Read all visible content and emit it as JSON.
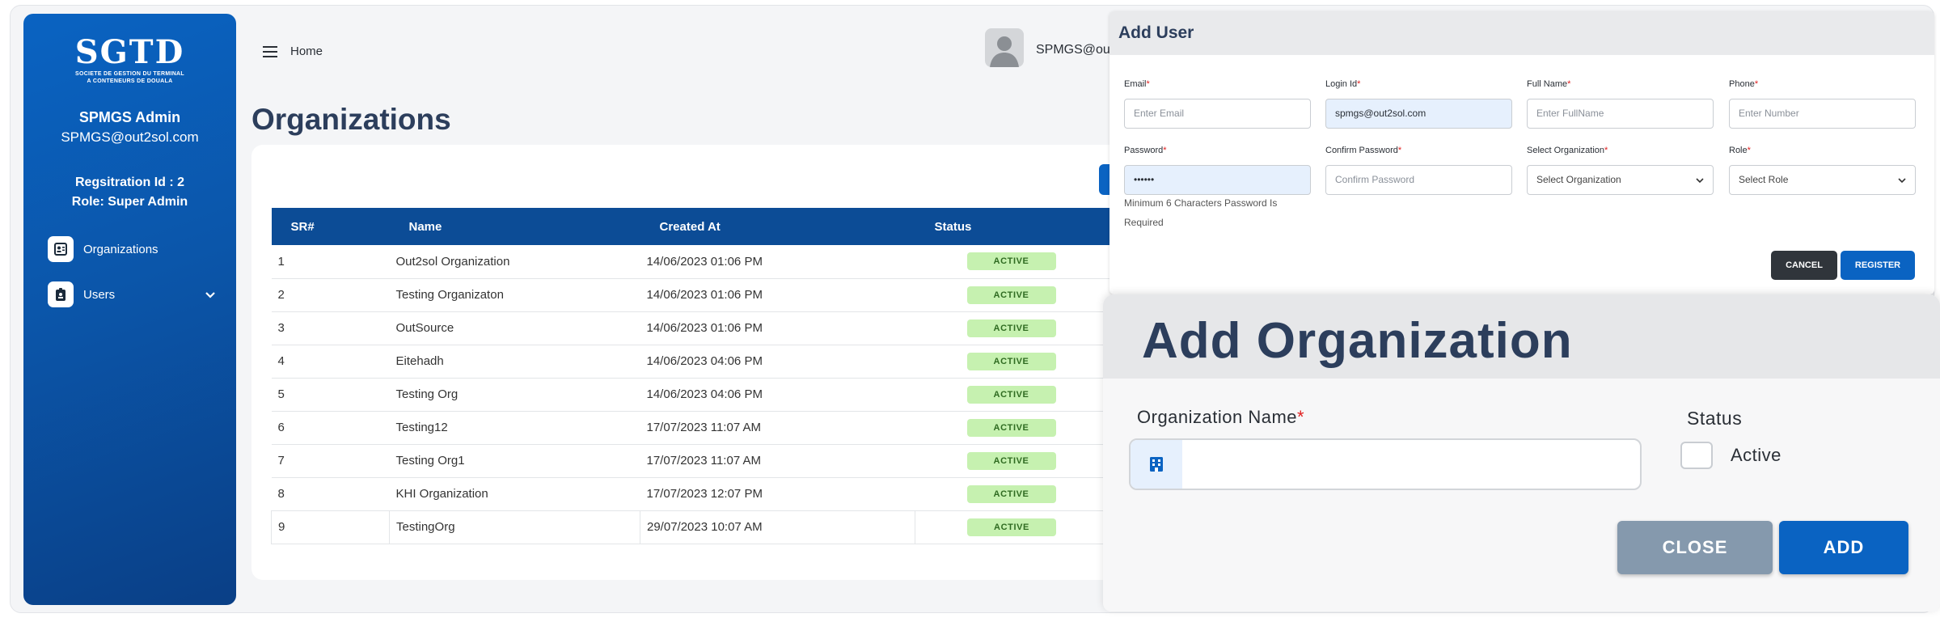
{
  "sidebar": {
    "logo_text": "SGTD",
    "logo_tagline_1": "SOCIETE DE GESTION DU TERMINAL",
    "logo_tagline_2": "A CONTENEURS DE DOUALA",
    "user_name": "SPMGS Admin",
    "user_email": "SPMGS@out2sol.com",
    "registration": "Regsitration Id : 2",
    "role": "Role: Super Admin",
    "nav": [
      {
        "label": "Organizations",
        "icon": "id-card-icon"
      },
      {
        "label": "Users",
        "icon": "id-badge-icon",
        "has_dropdown": true
      }
    ]
  },
  "topbar": {
    "breadcrumb": "Home",
    "user_display": "SPMGS@ou"
  },
  "page": {
    "title": "Organizations"
  },
  "table": {
    "columns": [
      "SR#",
      "Name",
      "Created At",
      "Status"
    ],
    "rows": [
      {
        "sr": "1",
        "name": "Out2sol Organization",
        "created": "14/06/2023 01:06 PM",
        "status": "ACTIVE"
      },
      {
        "sr": "2",
        "name": "Testing Organizaton",
        "created": "14/06/2023 01:06 PM",
        "status": "ACTIVE"
      },
      {
        "sr": "3",
        "name": "OutSource",
        "created": "14/06/2023 01:06 PM",
        "status": "ACTIVE"
      },
      {
        "sr": "4",
        "name": "Eitehadh",
        "created": "14/06/2023 04:06 PM",
        "status": "ACTIVE"
      },
      {
        "sr": "5",
        "name": "Testing Org",
        "created": "14/06/2023 04:06 PM",
        "status": "ACTIVE"
      },
      {
        "sr": "6",
        "name": "Testing12",
        "created": "17/07/2023 11:07 AM",
        "status": "ACTIVE"
      },
      {
        "sr": "7",
        "name": "Testing Org1",
        "created": "17/07/2023 11:07 AM",
        "status": "ACTIVE"
      },
      {
        "sr": "8",
        "name": "KHI Organization",
        "created": "17/07/2023 12:07 PM",
        "status": "ACTIVE"
      },
      {
        "sr": "9",
        "name": "TestingOrg",
        "created": "29/07/2023 10:07 AM",
        "status": "ACTIVE"
      }
    ]
  },
  "add_user": {
    "title": "Add User",
    "email": {
      "label": "Email",
      "placeholder": "Enter Email",
      "value": ""
    },
    "login_id": {
      "label": "Login Id",
      "value": "spmgs@out2sol.com"
    },
    "full_name": {
      "label": "Full Name",
      "placeholder": "Enter FullName"
    },
    "phone": {
      "label": "Phone",
      "placeholder": "Enter Number"
    },
    "password": {
      "label": "Password",
      "value": "••••••"
    },
    "confirm_password": {
      "label": "Confirm Password",
      "placeholder": "Confirm Password"
    },
    "organization": {
      "label": "Select Organization",
      "selected": "Select Organization"
    },
    "role": {
      "label": "Role",
      "selected": "Select Role"
    },
    "password_hint": "Minimum 6 Characters Password Is Required",
    "cancel_label": "CANCEL",
    "register_label": "REGISTER"
  },
  "add_org": {
    "title": "Add Organization",
    "name_label": "Organization Name",
    "status_label": "Status",
    "active_label": "Active",
    "active_checked": false,
    "close_label": "CLOSE",
    "add_label": "ADD"
  },
  "colors": {
    "primary": "#0a63c2",
    "table_header": "#0c4c96",
    "active_badge_bg": "#c6f1b0",
    "required": "#e02020"
  }
}
